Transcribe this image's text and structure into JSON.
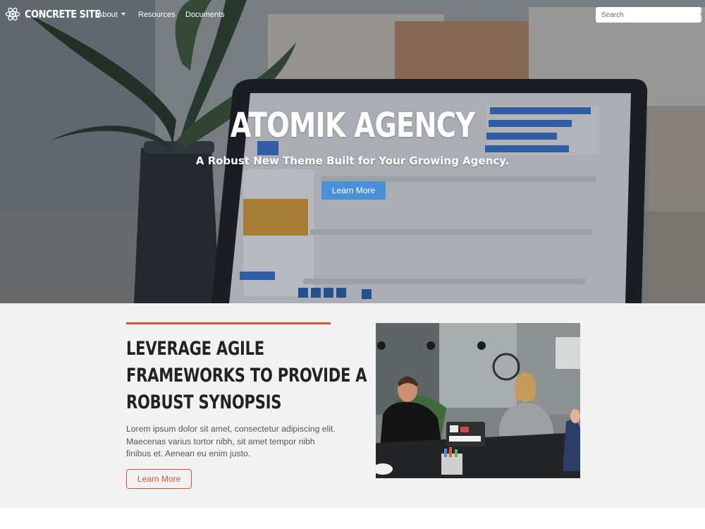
{
  "nav": {
    "brand": "CONCRETE SITE",
    "links": [
      {
        "label": "About",
        "has_dropdown": true
      },
      {
        "label": "Resources"
      },
      {
        "label": "Documents"
      }
    ],
    "search": {
      "placeholder": "Search",
      "icon": "search-icon"
    }
  },
  "hero": {
    "title": "ATOMIK AGENCY",
    "subtitle": "A Robust New Theme Built for Your Growing Agency.",
    "cta_label": "Learn More"
  },
  "feature": {
    "heading_lines": [
      "LEVERAGE AGILE",
      "FRAMEWORKS TO PROVIDE A",
      "ROBUST SYNOPSIS"
    ],
    "body": "Lorem ipsum dolor sit amet, consectetur adipiscing elit. Maecenas varius tortor nibh, sit amet tempor nibh finibus et. Aenean eu enim justo.",
    "button_label": "Learn More"
  },
  "colors": {
    "accent": "#d9532b",
    "primary_button": "#4a90d9",
    "section_bg": "#f2f2f2",
    "heading_text": "#222222"
  }
}
